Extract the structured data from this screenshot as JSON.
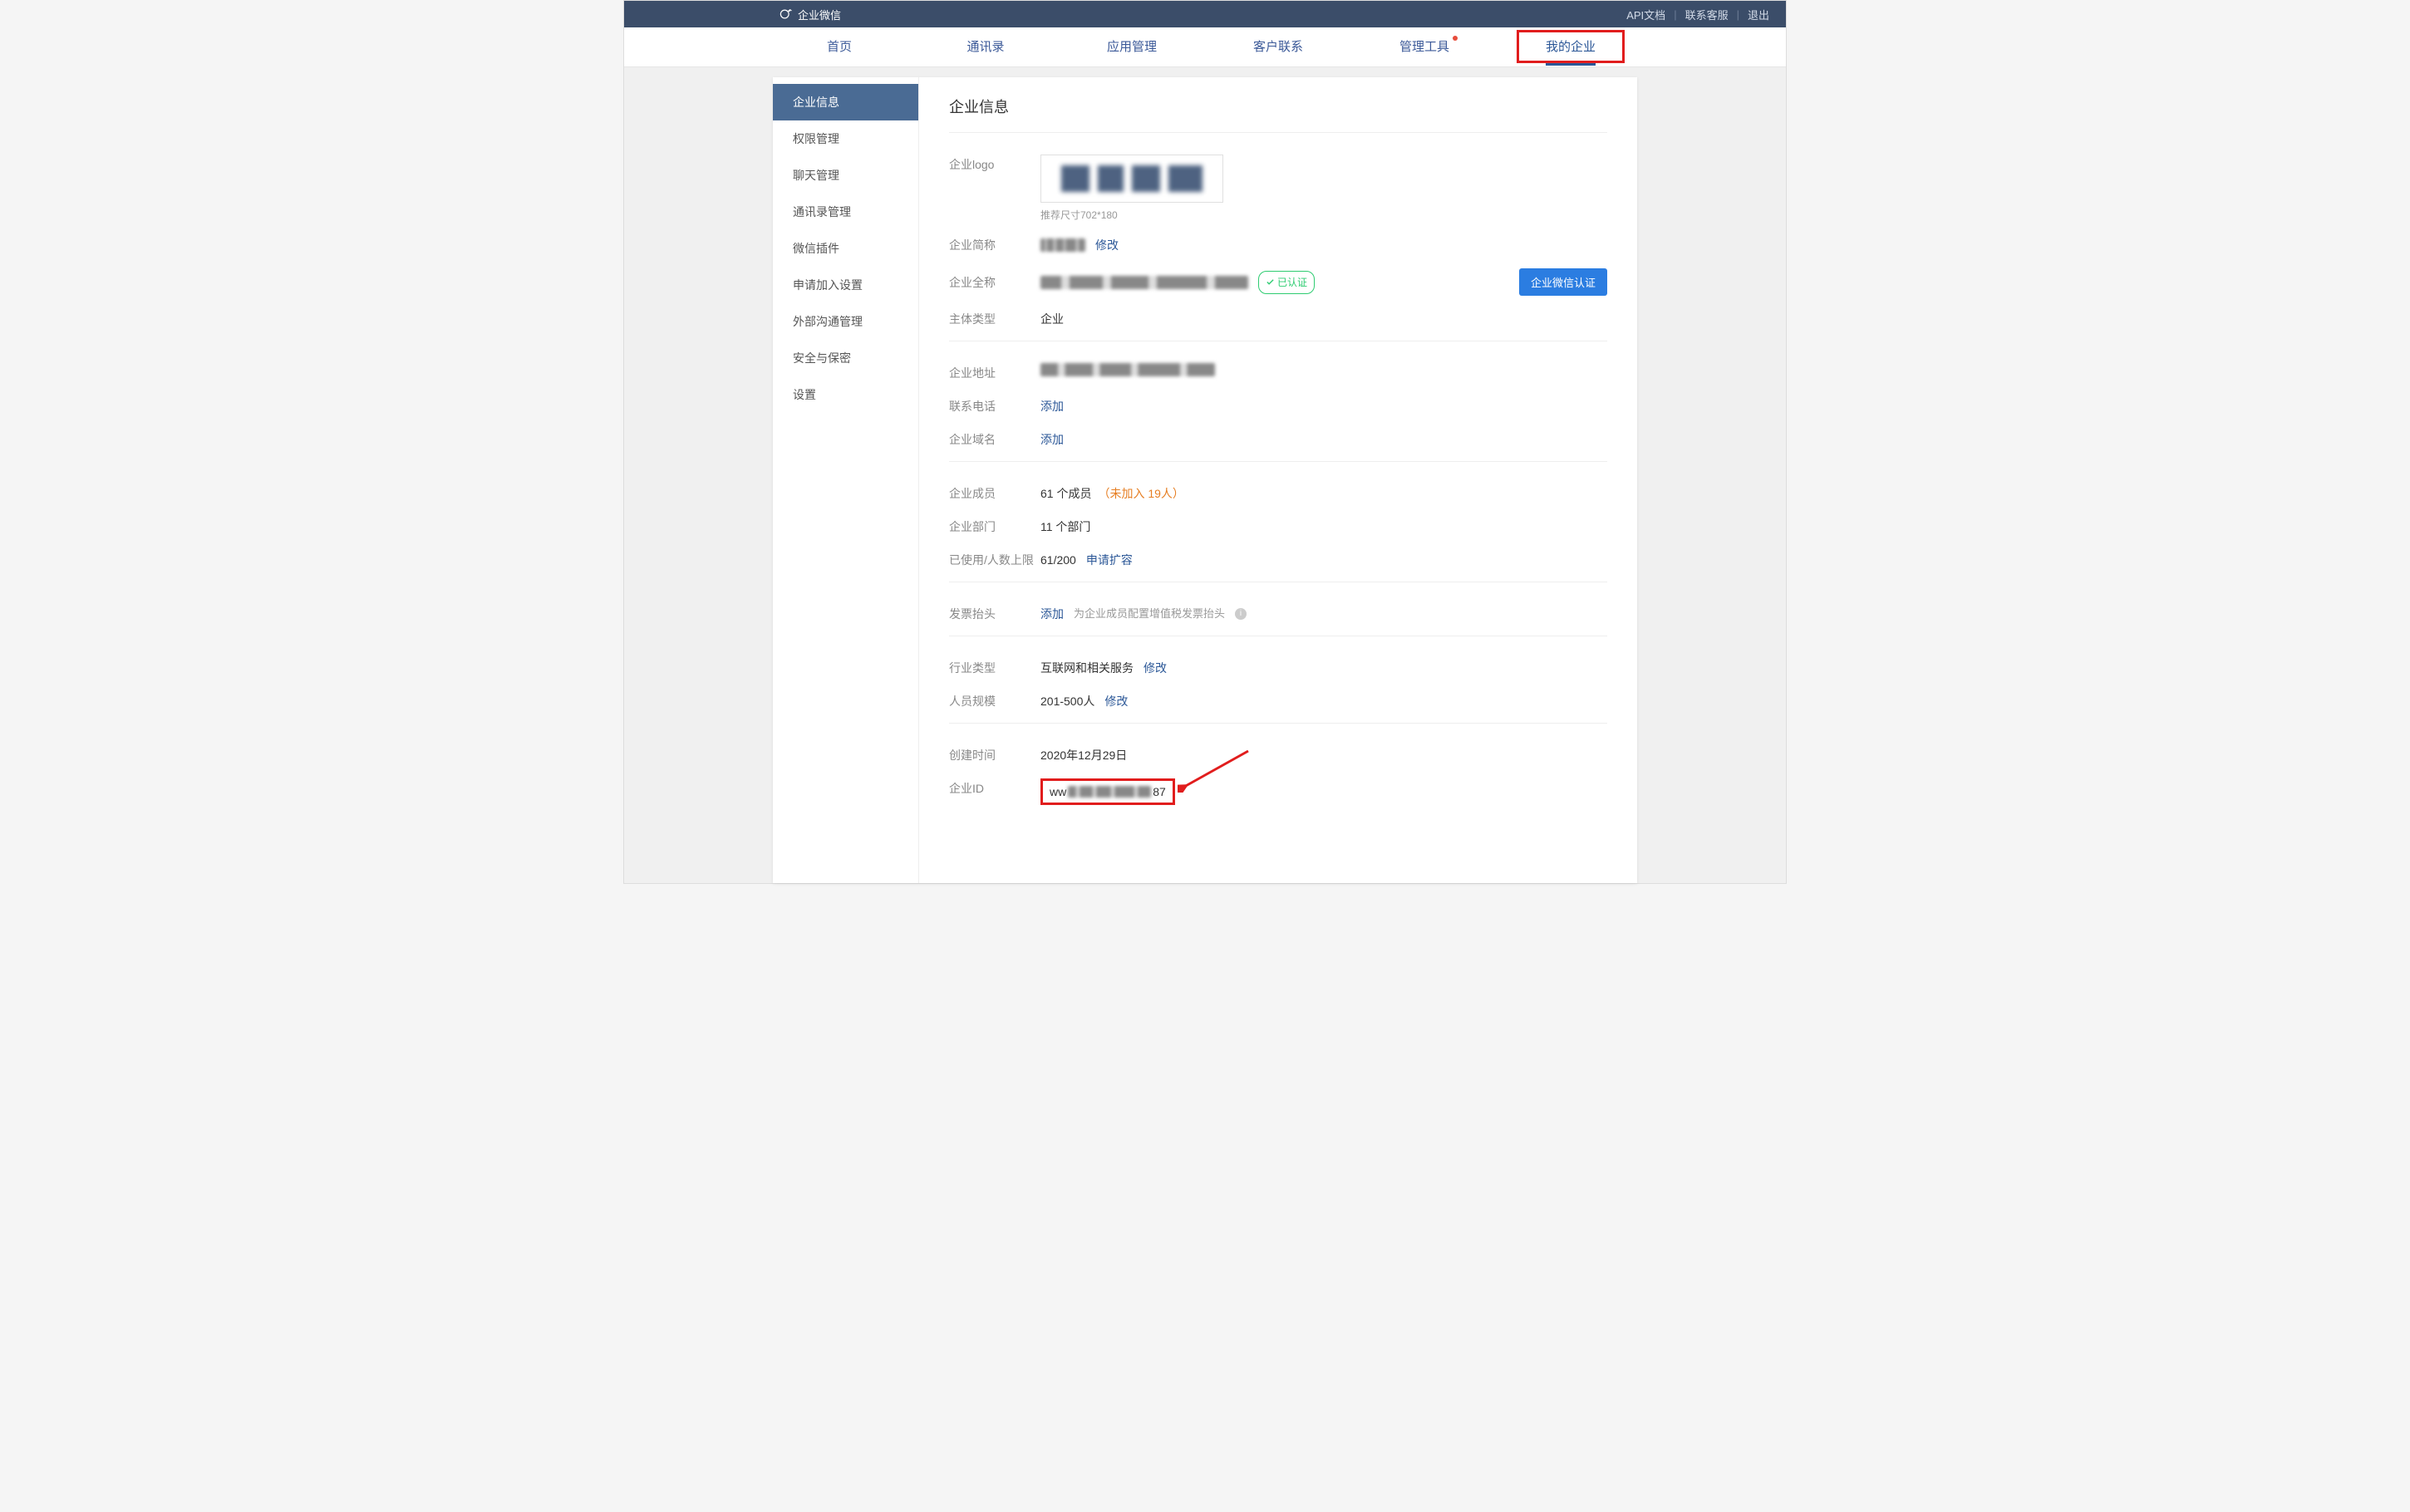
{
  "topbar": {
    "brand": "企业微信",
    "api_doc": "API文档",
    "contact": "联系客服",
    "logout": "退出"
  },
  "nav": {
    "items": [
      {
        "label": "首页"
      },
      {
        "label": "通讯录"
      },
      {
        "label": "应用管理"
      },
      {
        "label": "客户联系"
      },
      {
        "label": "管理工具"
      },
      {
        "label": "我的企业"
      }
    ]
  },
  "sidebar": {
    "items": [
      {
        "label": "企业信息"
      },
      {
        "label": "权限管理"
      },
      {
        "label": "聊天管理"
      },
      {
        "label": "通讯录管理"
      },
      {
        "label": "微信插件"
      },
      {
        "label": "申请加入设置"
      },
      {
        "label": "外部沟通管理"
      },
      {
        "label": "安全与保密"
      },
      {
        "label": "设置"
      }
    ]
  },
  "page": {
    "title": "企业信息",
    "logo": {
      "label": "企业logo",
      "hint": "推荐尺寸702*180"
    },
    "short_name": {
      "label": "企业简称",
      "action": "修改"
    },
    "full_name": {
      "label": "企业全称",
      "verified": "已认证",
      "verify_btn": "企业微信认证"
    },
    "entity_type": {
      "label": "主体类型",
      "value": "企业"
    },
    "address": {
      "label": "企业地址"
    },
    "phone": {
      "label": "联系电话",
      "action": "添加"
    },
    "domain": {
      "label": "企业域名",
      "action": "添加"
    },
    "members": {
      "label": "企业成员",
      "value": "61 个成员",
      "unjoined": "（未加入 19人）"
    },
    "departments": {
      "label": "企业部门",
      "value": "11 个部门"
    },
    "used": {
      "label": "已使用/人数上限",
      "value": "61/200",
      "action": "申请扩容"
    },
    "invoice": {
      "label": "发票抬头",
      "action": "添加",
      "hint": "为企业成员配置增值税发票抬头"
    },
    "industry": {
      "label": "行业类型",
      "value": "互联网和相关服务",
      "action": "修改"
    },
    "size": {
      "label": "人员规模",
      "value": "201-500人",
      "action": "修改"
    },
    "created": {
      "label": "创建时间",
      "value": "2020年12月29日"
    },
    "corp_id": {
      "label": "企业ID",
      "prefix": "ww",
      "suffix": "87"
    }
  }
}
